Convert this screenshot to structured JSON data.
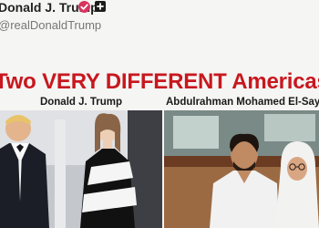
{
  "post": {
    "author_name": "Donald J. Trump",
    "author_handle": "@realDonaldTrump",
    "headline": "Two VERY DIFFERENT Americas",
    "panels": [
      {
        "caption": "Donald J. Trump"
      },
      {
        "caption": "Abdulrahman Mohamed El-Sayed"
      }
    ]
  },
  "colors": {
    "headline": "#c8171e",
    "verified_badge": "#d7345f",
    "handle": "#777777"
  },
  "icons": {
    "verified": "verified-badge-icon",
    "plus": "plus-badge-icon"
  }
}
